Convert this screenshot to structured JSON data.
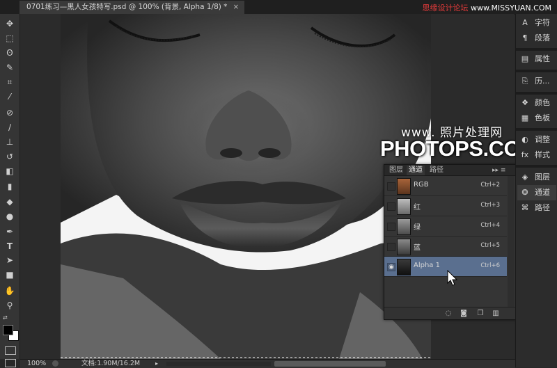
{
  "document_tab": {
    "title": "0701练习—黑人女孩特写.psd @ 100% (背景, Alpha 1/8) *",
    "close": "×"
  },
  "watermark_top": {
    "part1": "思缘设计论坛",
    "part2": " www.MISSYUAN.COM"
  },
  "toolbar": {
    "tools": [
      "move-icon",
      "marquee-icon",
      "lasso-icon",
      "quick-select-icon",
      "crop-icon",
      "eyedropper-icon",
      "healing-brush-icon",
      "brush-icon",
      "clone-stamp-icon",
      "history-brush-icon",
      "eraser-icon",
      "gradient-icon",
      "blur-icon",
      "dodge-icon",
      "pen-icon",
      "type-icon",
      "path-select-icon",
      "shape-icon",
      "hand-icon",
      "zoom-icon"
    ]
  },
  "dock": {
    "items": [
      {
        "icon": "character-icon",
        "label": "字符"
      },
      {
        "icon": "paragraph-icon",
        "label": "段落"
      },
      {
        "icon": "properties-icon",
        "label": "属性"
      },
      {
        "icon": "history-icon",
        "label": "历..."
      },
      {
        "icon": "color-icon",
        "label": "颜色"
      },
      {
        "icon": "swatches-icon",
        "label": "色板"
      },
      {
        "icon": "adjustments-icon",
        "label": "调整"
      },
      {
        "icon": "styles-icon",
        "label": "样式"
      },
      {
        "icon": "layers-icon",
        "label": "图层"
      },
      {
        "icon": "channels-icon",
        "label": "通道"
      },
      {
        "icon": "paths-icon",
        "label": "路径"
      }
    ]
  },
  "channels_panel": {
    "tabs": [
      "图层",
      "通道",
      "路径"
    ],
    "active_tab": "通道",
    "menu": "▸▸ ≡",
    "rows": [
      {
        "name": "RGB",
        "shortcut": "Ctrl+2",
        "visible": false
      },
      {
        "name": "红",
        "shortcut": "Ctrl+3",
        "visible": false
      },
      {
        "name": "绿",
        "shortcut": "Ctrl+4",
        "visible": false
      },
      {
        "name": "蓝",
        "shortcut": "Ctrl+5",
        "visible": false
      },
      {
        "name": "Alpha 1",
        "shortcut": "Ctrl+6",
        "visible": true,
        "selected": true
      }
    ],
    "bottom_buttons": [
      "load-selection-icon",
      "save-selection-icon",
      "new-channel-icon",
      "delete-channel-icon"
    ]
  },
  "watermark": {
    "line1": "www.   照片处理网",
    "line2": "PHOTOPS.COM"
  },
  "status": {
    "zoom": "100%",
    "doc": "文档:1.90M/16.2M"
  },
  "colors": {
    "selection_highlight": "#5a6f8f",
    "watermark_red": "#e63b3b"
  }
}
